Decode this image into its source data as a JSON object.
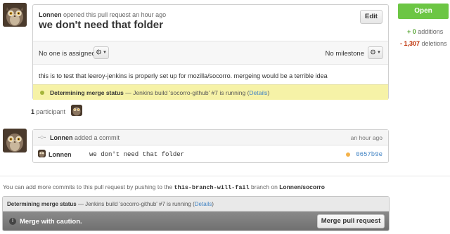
{
  "pr": {
    "author": "Lonnen",
    "meta_suffix": "opened this pull request an hour ago",
    "title": "we don't need that folder",
    "edit_label": "Edit",
    "assignee_text": "No one is assigned",
    "milestone_text": "No milestone",
    "description": "this is to test that leeroy-jenkins is properly set up for mozilla/socorro. mergeing would be a terrible idea",
    "status_label": "Determining merge status",
    "status_detail": "— Jenkins build 'socorro-github' #7 is running (",
    "status_link": "Details",
    "status_close": ")"
  },
  "sidebar": {
    "state_label": "Open",
    "additions_count": "+ 0",
    "additions_label": "additions",
    "deletions_count": "- 1,307",
    "deletions_label": "deletions"
  },
  "participants": {
    "count": "1",
    "label": "participant"
  },
  "commit": {
    "author": "Lonnen",
    "action": "added a commit",
    "time": "an hour ago",
    "row_author": "Lonnen",
    "message": "we don't need that folder",
    "sha": "0657b9e"
  },
  "push_note": {
    "prefix": "You can add more commits to this pull request by pushing to the",
    "branch": "this-branch-will-fail",
    "middle": "branch on",
    "repo": "Lonnen/socorro"
  },
  "merge": {
    "status_label": "Determining merge status",
    "status_detail": "— Jenkins build 'socorro-github' #7 is running (",
    "status_link": "Details",
    "status_close": ")",
    "caution_text": "Merge with caution.",
    "button_label": "Merge pull request"
  },
  "colors": {
    "open_green": "#6cc644",
    "status_yellow": "#f6f2a7",
    "link_blue": "#4183c4",
    "additions_green": "#55a532",
    "deletions_red": "#bd2c00",
    "merge_bar_gray": "#7a7a7a"
  },
  "icons": {
    "gear": "gear-icon",
    "commit": "commit-icon",
    "caution": "caution-icon",
    "avatar": "owl-avatar"
  }
}
